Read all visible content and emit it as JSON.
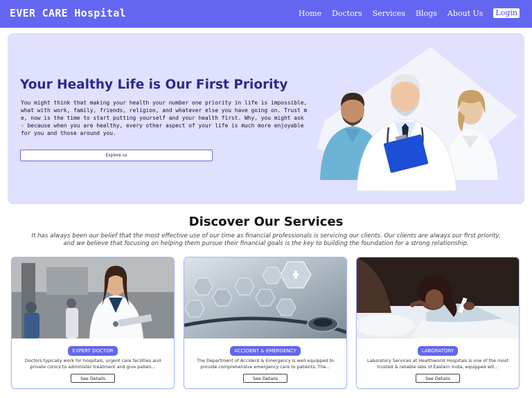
{
  "nav": {
    "brand": "EVER CARE Hospital",
    "links": [
      "Home",
      "Doctors",
      "Services",
      "Blogs",
      "About Us"
    ],
    "login": "Login"
  },
  "hero": {
    "title": "Your Healthy Life is Our First Priority",
    "text": "You might think that making your health your number one priority in life is impossible, what with work, family, friends, religion, and whatever else you have going on. Trust me, now is the time to start putting yourself and your health first. Why, you might ask - because when you are healthy, every other aspect of your life is much more enjoyable for you and those around you.",
    "button": "Explore us"
  },
  "services": {
    "title": "Discover Our Services",
    "subtitle": "It has always been our belief that the most effective use of our time as financial professionals is servicing our clients. Our clients are always our first priority, and we believe that focusing on helping them pursue their financial goals is the key to building the foundation for a strong relationship.",
    "cards": [
      {
        "badge": "EXPERT DOCTOR",
        "text": "Doctors typically work for hospitals, urgent care facilities and private clinics to administer treatment and give patien...",
        "button": "See Details",
        "image": "doctor-with-tablet"
      },
      {
        "badge": "ACCIDENT & EMERGENCY",
        "text": "The Department of Accident & Emergency is well equipped to provide comprehensive emergency care to patients. The...",
        "button": "See Details",
        "image": "stethoscope-medical-icons"
      },
      {
        "badge": "LABORATORY",
        "text": "Laboratory Services at Healthworld Hospitals is one of the most trusted & reliable labs of Eastern India, equipped wit...",
        "button": "See Details",
        "image": "child-with-thermometer"
      }
    ]
  },
  "colors": {
    "primary": "#6366f1",
    "hero_bg": "#e0e0ff",
    "title": "#2a2a8f"
  }
}
